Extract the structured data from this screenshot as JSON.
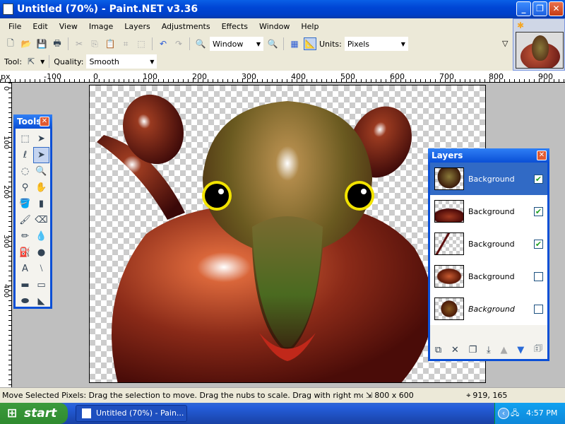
{
  "window": {
    "title": "Untitled (70%) - Paint.NET v3.36",
    "minimize": "_",
    "restore": "❐",
    "close": "✕"
  },
  "menu": [
    "File",
    "Edit",
    "View",
    "Image",
    "Layers",
    "Adjustments",
    "Effects",
    "Window",
    "Help"
  ],
  "toolbar": {
    "zoom_value": "Window",
    "units_label": "Units:",
    "units_value": "Pixels"
  },
  "toolrow": {
    "tool_label": "Tool:",
    "quality_label": "Quality:",
    "quality_value": "Smooth"
  },
  "ruler": {
    "unit": "px",
    "top_ticks": [
      "-100",
      "0",
      "100",
      "200",
      "300",
      "400",
      "500",
      "600",
      "700",
      "800",
      "900"
    ],
    "left_ticks": [
      "0",
      "100",
      "200",
      "300",
      "400"
    ]
  },
  "tools_window": {
    "title": "Tools",
    "close": "✕",
    "icons": [
      "rectangle-select",
      "move-selection",
      "lasso-select",
      "move-selected-pixels",
      "ellipse-select",
      "zoom",
      "magic-wand",
      "pan",
      "paint-bucket",
      "gradient",
      "paintbrush",
      "eraser",
      "pencil",
      "color-picker",
      "clone-stamp",
      "recolor",
      "text",
      "line-curve",
      "rectangle",
      "rounded-rectangle",
      "ellipse",
      "freeform-shape"
    ],
    "selected": "move-selected-pixels"
  },
  "layers_window": {
    "title": "Layers",
    "close": "✕",
    "layers": [
      {
        "name": "Background",
        "visible": true,
        "selected": true
      },
      {
        "name": "Background",
        "visible": true
      },
      {
        "name": "Background",
        "visible": true
      },
      {
        "name": "Background",
        "visible": false
      },
      {
        "name": "Background",
        "visible": false
      }
    ],
    "buttons": [
      "add-layer",
      "delete-layer",
      "duplicate-layer",
      "merge-layer-down",
      "move-layer-up",
      "move-layer-down",
      "layer-properties"
    ]
  },
  "status": {
    "hint": "Move Selected Pixels: Drag the selection to move. Drag the nubs to scale. Drag with right mouse button to",
    "image_size": "800 x 600",
    "cursor": "919, 165"
  },
  "taskbar": {
    "start": "start",
    "task": "Untitled (70%) - Pain...",
    "clock": "4:57 PM"
  },
  "colors": {
    "accent": "#316ac5",
    "titlebar": "#0046d5",
    "workspace": "#bfbfbf"
  }
}
